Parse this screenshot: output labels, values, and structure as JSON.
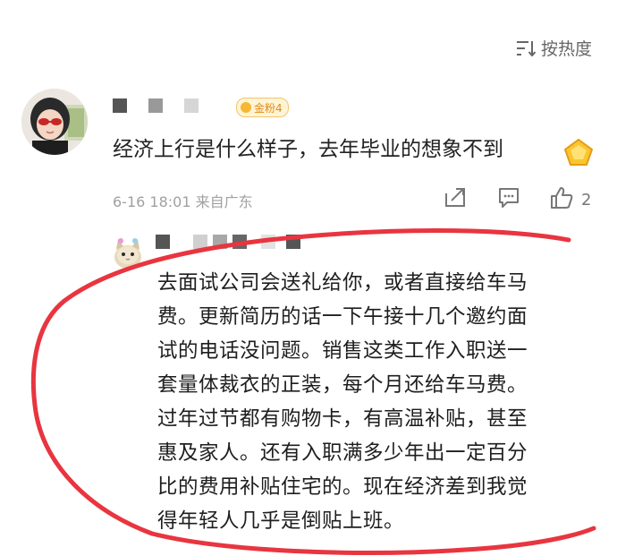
{
  "sort": {
    "label": "按热度",
    "icon": "sort-icon"
  },
  "comment": {
    "avatar": "avatar-girl-sunglasses",
    "badge_label": "金粉4",
    "text": "经济上行是什么样子，去年毕业的想象不到",
    "sticker": "gold-gem-emoji",
    "timestamp": "6-16 18:01",
    "location": "来自广东",
    "like_count": "2",
    "icons": [
      "share-icon",
      "comment-icon",
      "like-icon"
    ],
    "colors": {
      "badge_bg": "#fff4d6",
      "badge_text": "#e28a16",
      "meta": "#a0a0a0"
    }
  },
  "reply": {
    "avatar": "avatar-cat",
    "lines": [
      "去面试公司会送礼给你，或者直接给车马",
      "费。更新简历的话一下午接十几个邀约面",
      "试的电话没问题。销售这类工作入职送一",
      "套量体裁衣的正装，每个月还给车马费。",
      "过年过节都有购物卡，有高温补贴，甚至",
      "惠及家人。还有入职满多少年出一定百分",
      "比的费用补贴住宅的。现在经济差到我觉",
      "得年轻人几乎是倒贴上班。"
    ]
  },
  "annotation": {
    "color": "#e8353f"
  }
}
